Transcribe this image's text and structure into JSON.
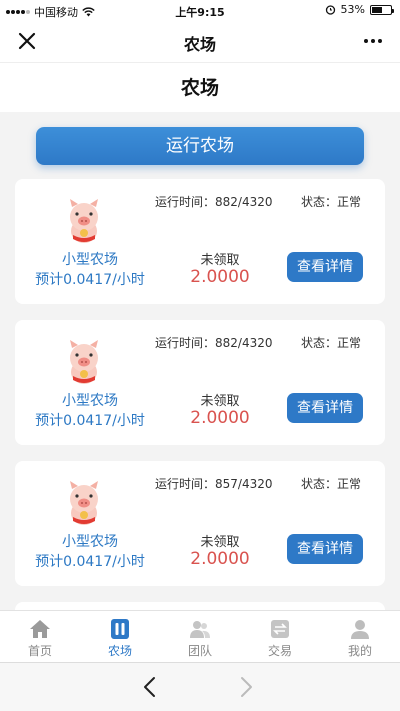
{
  "statusbar": {
    "carrier": "中国移动",
    "time": "上午9:15",
    "battery": "53%",
    "battery_level": 0.53
  },
  "nav": {
    "title": "农场"
  },
  "page": {
    "header": "农场"
  },
  "run_button": "运行农场",
  "cards": [
    {
      "runtime_label": "运行时间：",
      "runtime": "882/4320",
      "status_label": "状态：",
      "status": "正常",
      "name": "小型农场",
      "rate": "预计0.0417/小时",
      "unclaimed_label": "未领取",
      "unclaimed_value": "2.0000",
      "detail_button": "查看详情"
    },
    {
      "runtime_label": "运行时间：",
      "runtime": "882/4320",
      "status_label": "状态：",
      "status": "正常",
      "name": "小型农场",
      "rate": "预计0.0417/小时",
      "unclaimed_label": "未领取",
      "unclaimed_value": "2.0000",
      "detail_button": "查看详情"
    },
    {
      "runtime_label": "运行时间：",
      "runtime": "857/4320",
      "status_label": "状态：",
      "status": "正常",
      "name": "小型农场",
      "rate": "预计0.0417/小时",
      "unclaimed_label": "未领取",
      "unclaimed_value": "2.0000",
      "detail_button": "查看详情"
    }
  ],
  "tabs": [
    {
      "label": "首页",
      "icon": "home-icon"
    },
    {
      "label": "农场",
      "icon": "farm-icon",
      "active": true
    },
    {
      "label": "团队",
      "icon": "team-icon"
    },
    {
      "label": "交易",
      "icon": "trade-icon"
    },
    {
      "label": "我的",
      "icon": "profile-icon"
    }
  ],
  "colors": {
    "primary": "#2e79c7",
    "value_red": "#d9534f",
    "tab_inactive": "#888888"
  }
}
